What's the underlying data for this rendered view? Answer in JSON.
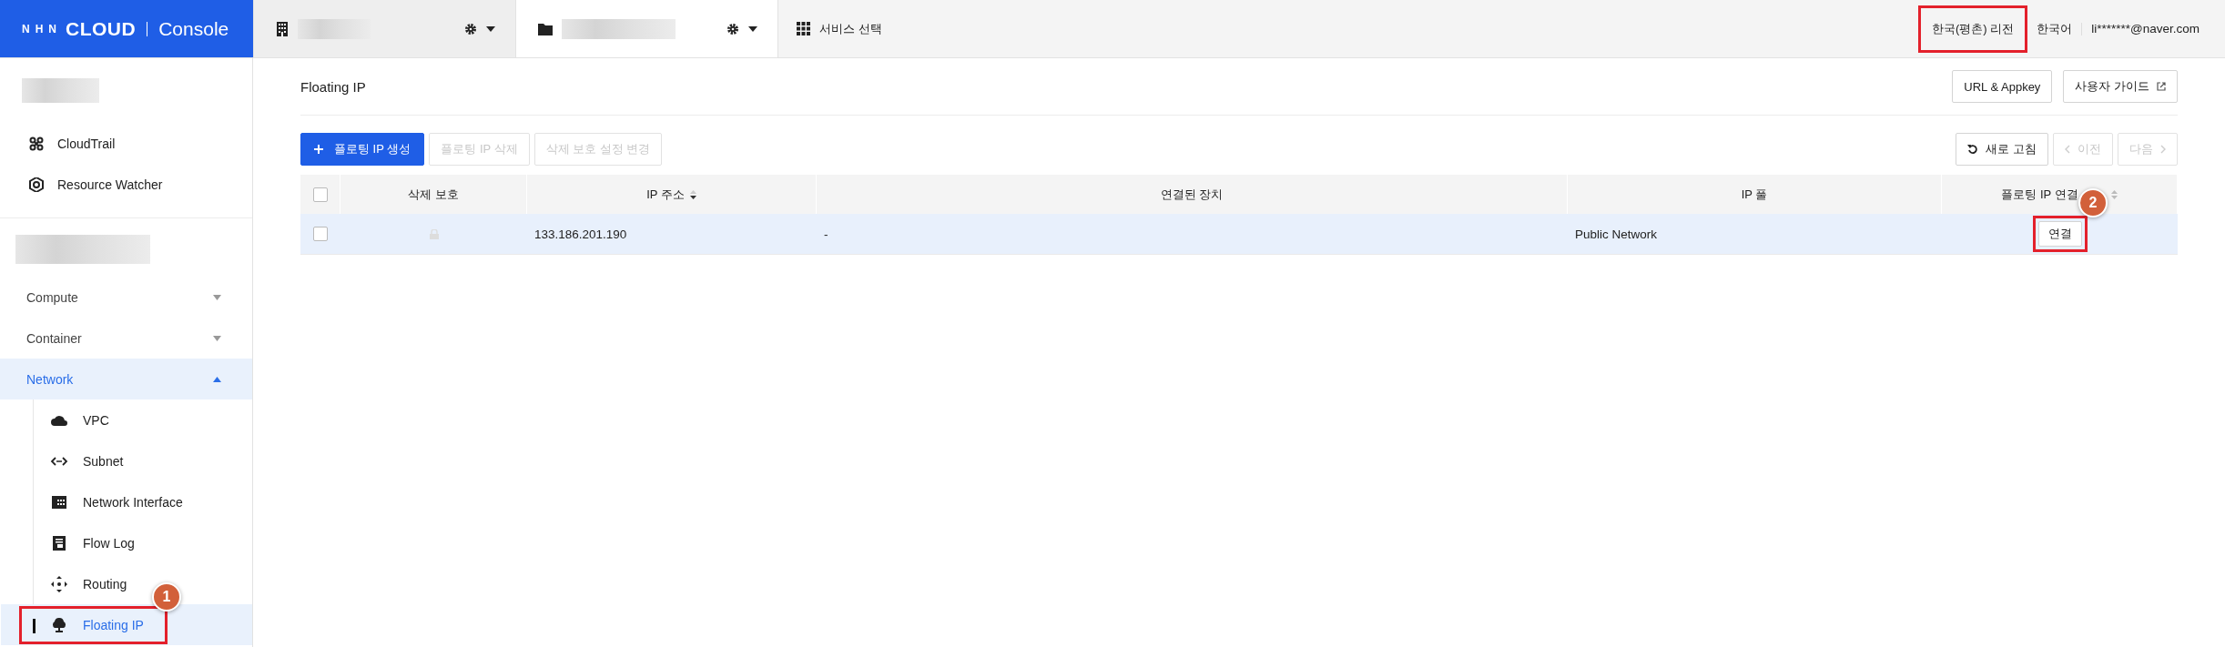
{
  "header": {
    "logo": {
      "brand_prefix": "NHN",
      "brand": "CLOUD",
      "product": "Console"
    },
    "tabs": [
      {
        "kind": "org",
        "selected": false
      },
      {
        "kind": "project",
        "selected": true
      }
    ],
    "service_select": "서비스 선택",
    "region": {
      "label": "한국(평촌) 리전",
      "highlighted": true
    },
    "language": "한국어",
    "account": "li*******@naver.com"
  },
  "sidebar": {
    "services": [
      {
        "label": "CloudTrail"
      },
      {
        "label": "Resource Watcher"
      }
    ],
    "categories": [
      {
        "label": "Compute",
        "expanded": false
      },
      {
        "label": "Container",
        "expanded": false
      },
      {
        "label": "Network",
        "expanded": true,
        "children": [
          {
            "label": "VPC",
            "selected": false
          },
          {
            "label": "Subnet",
            "selected": false
          },
          {
            "label": "Network Interface",
            "selected": false
          },
          {
            "label": "Flow Log",
            "selected": false
          },
          {
            "label": "Routing",
            "selected": false
          },
          {
            "label": "Floating IP",
            "selected": true,
            "highlighted": true,
            "callout": "1"
          }
        ]
      }
    ]
  },
  "page": {
    "title": "Floating IP",
    "links": [
      {
        "label": "URL & Appkey",
        "external": false
      },
      {
        "label": "사용자 가이드",
        "external": true
      }
    ],
    "actions": [
      {
        "label": "플로팅 IP 생성",
        "kind": "primary",
        "disabled": false
      },
      {
        "label": "플로팅 IP 삭제",
        "kind": "plain",
        "disabled": true
      },
      {
        "label": "삭제 보호 설정 변경",
        "kind": "plain",
        "disabled": true
      }
    ],
    "nav": [
      {
        "label": "새로 고침",
        "kind": "refresh",
        "disabled": false
      },
      {
        "label": "이전",
        "kind": "prev",
        "disabled": true
      },
      {
        "label": "다음",
        "kind": "next",
        "disabled": true
      }
    ],
    "table": {
      "select_all": {
        "checked": false
      },
      "columns": [
        {
          "label": "삭제 보호",
          "sortable": false
        },
        {
          "label": "IP 주소",
          "sortable": true
        },
        {
          "label": "연결된 장치",
          "sortable": false
        },
        {
          "label": "IP 풀",
          "sortable": false
        },
        {
          "label": "플로팅 IP 연결",
          "sortable": true
        }
      ],
      "rows": [
        {
          "selected": true,
          "checked": false,
          "protected": false,
          "ip": "133.186.201.190",
          "device": "-",
          "pool": "Public Network",
          "action": {
            "label": "연결",
            "highlighted": true,
            "callout": "2"
          }
        }
      ]
    }
  }
}
